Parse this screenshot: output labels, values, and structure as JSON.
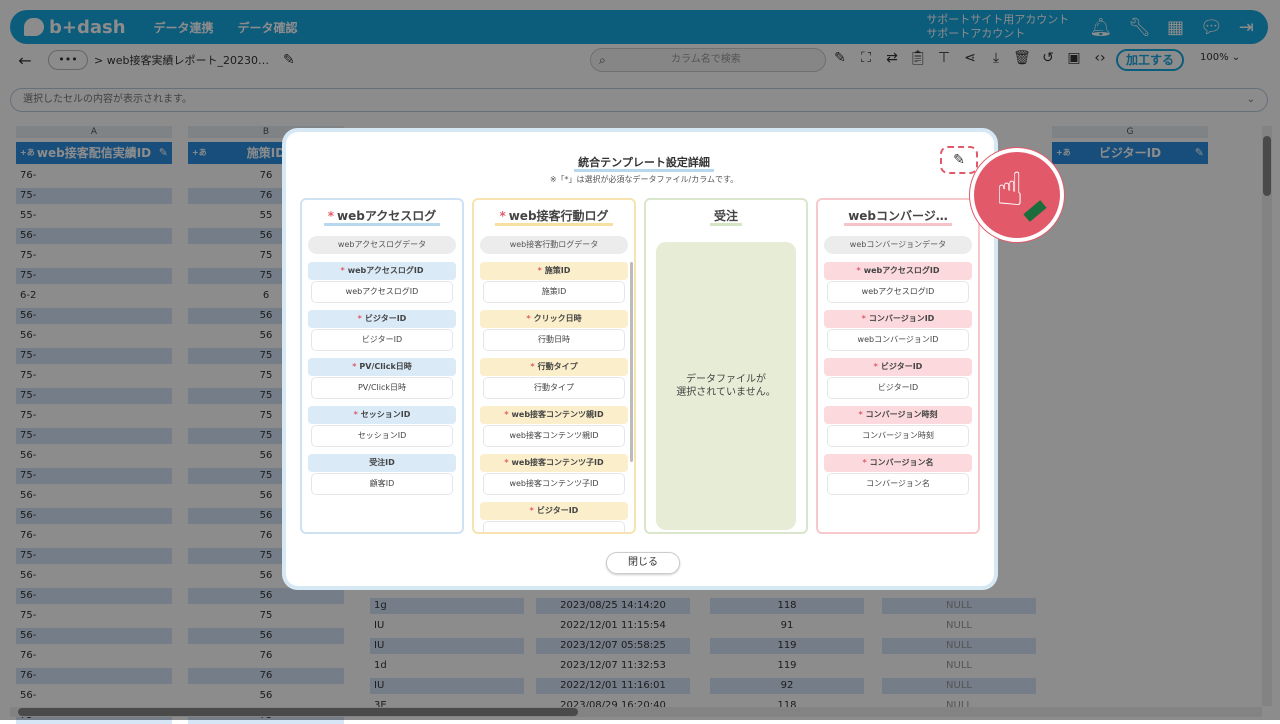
{
  "app": {
    "logo": "b+dash"
  },
  "nav": {
    "items": [
      "データ連携",
      "データ確認"
    ]
  },
  "account": {
    "line1": "サポートサイト用アカウント",
    "line2": "サポートアカウント"
  },
  "topbar_icons": [
    "bell-icon",
    "wrench-icon",
    "grid-icon",
    "chat-icon",
    "logout-icon"
  ],
  "toolbar": {
    "back": "←",
    "more": "•••",
    "breadcrumb": "> web接客実績レポート_20230…",
    "search_placeholder": "カラム名で検索",
    "process_label": "加工する",
    "zoom": "100%"
  },
  "cellbar": {
    "placeholder": "選択したセルの内容が表示されます。"
  },
  "columns": [
    {
      "letter": "A",
      "name": "web接客配信実績ID"
    },
    {
      "letter": "B",
      "name": "施策ID"
    },
    {
      "letter": "",
      "name": ""
    },
    {
      "letter": "",
      "name": ""
    },
    {
      "letter": "",
      "name": ""
    },
    {
      "letter": "",
      "name": ""
    },
    {
      "letter": "G",
      "name": "ビジターID"
    }
  ],
  "col_a_prefixes": [
    "76-",
    "75-",
    "55-",
    "56-",
    "75-",
    "75-",
    "6-2",
    "56-",
    "56-",
    "75-",
    "75-",
    "75-",
    "75-",
    "75-",
    "56-",
    "75-",
    "56-",
    "56-",
    "76-",
    "75-",
    "56-",
    "56-",
    "75-",
    "56-",
    "76-",
    "76-",
    "56-",
    "75-"
  ],
  "col_b_values": [
    "76",
    "76",
    "55",
    "56",
    "75",
    "75",
    "6",
    "56",
    "56",
    "75",
    "75",
    "75",
    "75",
    "75",
    "56",
    "75",
    "56",
    "56",
    "76",
    "75",
    "56",
    "56",
    "75",
    "56",
    "76",
    "76",
    "56",
    "75"
  ],
  "bottom_rows": [
    {
      "c": "1g",
      "d": "2023/08/25 14:14:20",
      "e": "118",
      "f": "NULL"
    },
    {
      "c": "IU",
      "d": "2022/12/01 11:15:54",
      "e": "91",
      "f": "NULL"
    },
    {
      "c": "IU",
      "d": "2023/12/07 05:58:25",
      "e": "119",
      "f": "NULL"
    },
    {
      "c": "1d",
      "d": "2023/12/07 11:32:53",
      "e": "119",
      "f": "NULL"
    },
    {
      "c": "IU",
      "d": "2022/12/01 11:16:01",
      "e": "92",
      "f": "NULL"
    },
    {
      "c": "3E",
      "d": "2023/08/29 16:20:40",
      "e": "118",
      "f": "NULL"
    }
  ],
  "modal": {
    "title": "統合テンプレート設定詳細",
    "note": "※「*」は選択が必須なデータファイル/カラムです。",
    "close_label": "閉じる",
    "cards": [
      {
        "title": "webアクセスログ",
        "required": true,
        "file": "webアクセスログデータ",
        "fields": [
          {
            "label": "webアクセスログID",
            "required": true,
            "value": "webアクセスログID"
          },
          {
            "label": "ビジターID",
            "required": true,
            "value": "ビジターID"
          },
          {
            "label": "PV/Click日時",
            "required": true,
            "value": "PV/Click日時"
          },
          {
            "label": "セッションID",
            "required": true,
            "value": "セッションID"
          },
          {
            "label": "受注ID",
            "required": false,
            "value": "顧客ID"
          }
        ]
      },
      {
        "title": "web接客行動ログ",
        "required": true,
        "file": "web接客行動ログデータ",
        "fields": [
          {
            "label": "施策ID",
            "required": true,
            "value": "施策ID"
          },
          {
            "label": "クリック日時",
            "required": true,
            "value": "行動日時"
          },
          {
            "label": "行動タイプ",
            "required": true,
            "value": "行動タイプ"
          },
          {
            "label": "web接客コンテンツ親ID",
            "required": true,
            "value": "web接客コンテンツ親ID"
          },
          {
            "label": "web接客コンテンツ子ID",
            "required": true,
            "value": "web接客コンテンツ子ID"
          },
          {
            "label": "ビジターID",
            "required": true,
            "value": ""
          }
        ]
      },
      {
        "title": "受注",
        "required": false,
        "empty": "データファイルが\n選択されていません。"
      },
      {
        "title": "webコンバージ…",
        "required": false,
        "file": "webコンバージョンデータ",
        "fields": [
          {
            "label": "webアクセスログID",
            "required": true,
            "value": "webアクセスログID"
          },
          {
            "label": "コンバージョンID",
            "required": true,
            "value": "webコンバージョンID"
          },
          {
            "label": "ビジターID",
            "required": true,
            "value": "ビジターID"
          },
          {
            "label": "コンバージョン時刻",
            "required": true,
            "value": "コンバージョン時刻"
          },
          {
            "label": "コンバージョン名",
            "required": true,
            "value": "コンバージョン名"
          }
        ]
      }
    ]
  },
  "colors": {
    "brand": "#17a8e0",
    "header": "#2b8ee0",
    "highlight": "#e25a6a"
  }
}
